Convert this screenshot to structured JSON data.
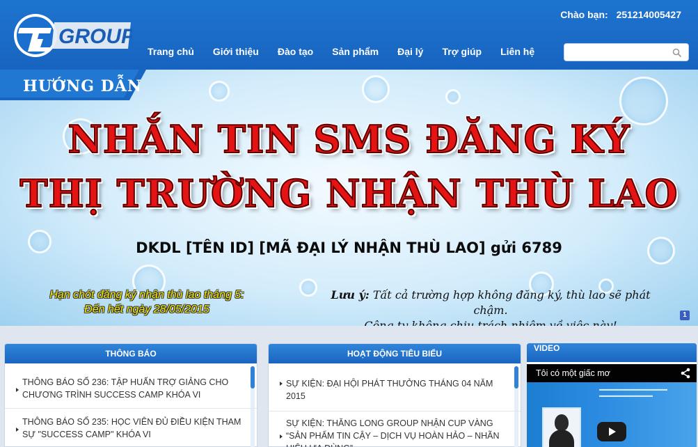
{
  "header": {
    "brand_name": "TL GROUP",
    "greeting_label": "Chào bạn:",
    "username": "251214005427",
    "nav": [
      "Trang chủ",
      "Giới thiệu",
      "Đào tạo",
      "Sản phẩm",
      "Đại lý",
      "Trợ giúp",
      "Liên hệ"
    ],
    "search": {
      "placeholder": "",
      "value": "",
      "icon": "search-icon"
    }
  },
  "banner": {
    "tab_label": "HƯỚNG DẪN",
    "headline_line1": "NHẮN TIN SMS ĐĂNG KÝ",
    "headline_line2": "THỊ TRƯỜNG NHẬN THÙ LAO",
    "sms_syntax": "DKDL [TÊN ID] [MÃ ĐẠI LÝ NHẬN THÙ LAO] gửi 6789",
    "deadline_line1": "Hạn chót đăng ký nhận thù lao tháng 5:",
    "deadline_line2": "Đến hết ngày 28/05/2015",
    "note_label": "Lưu ý:",
    "note_line1": " Tất cả trường hợp không đăng ký, thù lao sẽ phát chậm.",
    "note_line2": "Công ty không chịu trách nhiệm về việc này!",
    "slide_number": "1",
    "colors": {
      "headline": "#e41414",
      "deadline": "#f7e900",
      "tab": "#1766c2"
    }
  },
  "announcements": {
    "title": "THÔNG BÁO",
    "items": [
      "THÔNG BÁO SỐ 236: TẬP HUẤN TRỢ GIẢNG CHO CHƯƠNG TRÌNH SUCCESS CAMP KHÓA VI",
      "THÔNG BÁO SỐ 235: HỌC VIÊN ĐỦ ĐIỀU KIỆN THAM SỰ \"SUCCESS CAMP\" KHÓA VI"
    ]
  },
  "activities": {
    "title": "HOẠT ĐỘNG TIÊU BIỂU",
    "items": [
      "SỰ KIỆN: ĐẠI HỘI PHÁT THƯỞNG THÁNG 04 NĂM 2015",
      "SỰ KIỆN: THĂNG LONG GROUP NHẬN CUP VÀNG “SẢN PHẨM TIN CẬY – DỊCH VỤ HOÀN HẢO – NHÃN HIỆU ƯA DÙNG”"
    ]
  },
  "video": {
    "title": "VIDEO",
    "video_title": "Tôi có một giấc mơ",
    "share_icon": "share-icon",
    "play_icon": "play-icon"
  }
}
